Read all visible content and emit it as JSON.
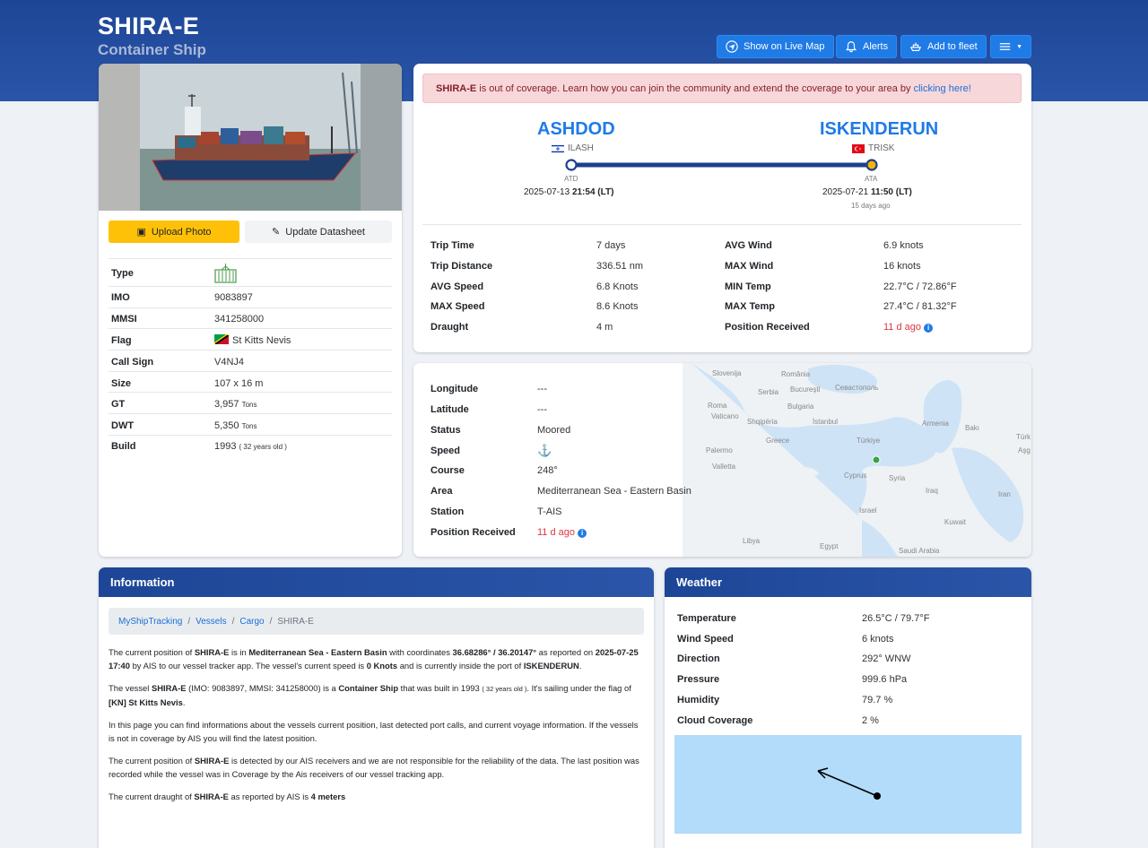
{
  "vessel": {
    "name": "SHIRA-E",
    "type": "Container Ship"
  },
  "header_buttons": {
    "live_map": "Show on Live Map",
    "alerts": "Alerts",
    "fleet": "Add to fleet"
  },
  "photo_buttons": {
    "upload": "Upload Photo",
    "update": "Update Datasheet"
  },
  "specs": [
    {
      "label": "Type",
      "value": ""
    },
    {
      "label": "IMO",
      "value": "9083897"
    },
    {
      "label": "MMSI",
      "value": "341258000"
    },
    {
      "label": "Flag",
      "value": "St Kitts Nevis"
    },
    {
      "label": "Call Sign",
      "value": "V4NJ4"
    },
    {
      "label": "Size",
      "value": "107 x 16 m"
    },
    {
      "label": "GT",
      "value": "3,957",
      "unit": "Tons"
    },
    {
      "label": "DWT",
      "value": "5,350",
      "unit": "Tons"
    },
    {
      "label": "Build",
      "value": "1993",
      "note": "( 32 years old )"
    }
  ],
  "alert": {
    "name": "SHIRA-E",
    "text": " is out of coverage. Learn how you can join the community and extend the coverage to your area by ",
    "link": "clicking here!"
  },
  "voyage": {
    "origin": {
      "name": "ASHDOD",
      "code": "ILASH",
      "label": "ATD",
      "date": "2025-07-13",
      "time": "21:54 (LT)"
    },
    "dest": {
      "name": "ISKENDERUN",
      "code": "TRISK",
      "label": "ATA",
      "date": "2025-07-21",
      "time": "11:50 (LT)",
      "ago": "15 days ago"
    }
  },
  "trip_left": [
    {
      "label": "Trip Time",
      "value": "7 days"
    },
    {
      "label": "Trip Distance",
      "value": "336.51 nm"
    },
    {
      "label": "AVG Speed",
      "value": "6.8 Knots"
    },
    {
      "label": "MAX Speed",
      "value": "8.6 Knots"
    },
    {
      "label": "Draught",
      "value": "4 m"
    }
  ],
  "trip_right": [
    {
      "label": "AVG Wind",
      "value": "6.9 knots"
    },
    {
      "label": "MAX Wind",
      "value": "16 knots"
    },
    {
      "label": "MIN Temp",
      "value": "22.7°C / 72.86°F"
    },
    {
      "label": "MAX Temp",
      "value": "27.4°C / 81.32°F"
    },
    {
      "label": "Position Received",
      "value": "11 d ago"
    }
  ],
  "position": [
    {
      "label": "Longitude",
      "value": "---"
    },
    {
      "label": "Latitude",
      "value": "---"
    },
    {
      "label": "Status",
      "value": "Moored"
    },
    {
      "label": "Speed",
      "value": ""
    },
    {
      "label": "Course",
      "value": "248°"
    },
    {
      "label": "Area",
      "value": "Mediterranean Sea - Eastern Basin"
    },
    {
      "label": "Station",
      "value": "T-AIS"
    },
    {
      "label": "Position Received",
      "value": "11 d ago"
    }
  ],
  "map_labels": [
    "Slovenija",
    "România",
    "Bucureşti",
    "Севастополь",
    "Serbia",
    "Bulgaria",
    "Roma",
    "Vaticano",
    "Shqipëria",
    "İstanbul",
    "Armenia",
    "Bakı",
    "Türk",
    "Aşg",
    "Greece",
    "Türkiye",
    "Palermo",
    "Valletta",
    "Cyprus",
    "Syria",
    "Iraq",
    "Iran",
    "Israel",
    "Kuwait",
    "Libya",
    "Egypt",
    "Saudi Arabia"
  ],
  "information": {
    "title": "Information",
    "crumbs": [
      "MyShipTracking",
      "Vessels",
      "Cargo",
      "SHIRA-E"
    ],
    "p1": [
      "The current position of ",
      "SHIRA-E",
      " is in ",
      "Mediterranean Sea - Eastern Basin",
      " with coordinates ",
      "36.68286° / 36.20147°",
      " as reported on ",
      "2025-07-25 17:40",
      " by AIS to our vessel tracker app. The vessel's current speed is ",
      "0 Knots",
      " and is currently inside the port of ",
      "ISKENDERUN",
      "."
    ],
    "p2": [
      "The vessel ",
      "SHIRA-E",
      " (IMO: 9083897, MMSI: 341258000) is a ",
      "Container Ship",
      " that was built in 1993 ",
      "( 32 years old )",
      ". It's sailing under the flag of ",
      "[KN] St Kitts Nevis",
      "."
    ],
    "p3": "In this page you can find informations about the vessels current position, last detected port calls, and current voyage information. If the vessels is not in coverage by AIS you will find the latest position.",
    "p4": [
      "The current position of ",
      "SHIRA-E",
      " is detected by our AIS receivers and we are not responsible for the reliability of the data. The last position was recorded while the vessel was in Coverage by the Ais receivers of our vessel tracking app."
    ],
    "p5": [
      "The current draught of ",
      "SHIRA-E",
      " as reported by AIS is ",
      "4 meters"
    ]
  },
  "weather": {
    "title": "Weather",
    "rows": [
      {
        "label": "Temperature",
        "value": "26.5°C / 79.7°F"
      },
      {
        "label": "Wind Speed",
        "value": "6 knots"
      },
      {
        "label": "Direction",
        "value": "292° WNW"
      },
      {
        "label": "Pressure",
        "value": "999.6 hPa"
      },
      {
        "label": "Humidity",
        "value": "79.7 %"
      },
      {
        "label": "Cloud Coverage",
        "value": "2 %"
      }
    ]
  },
  "colors": {
    "accent": "#1f7be6",
    "header": "#1e4697",
    "warning": "#ffc107",
    "danger": "#dc3545"
  }
}
